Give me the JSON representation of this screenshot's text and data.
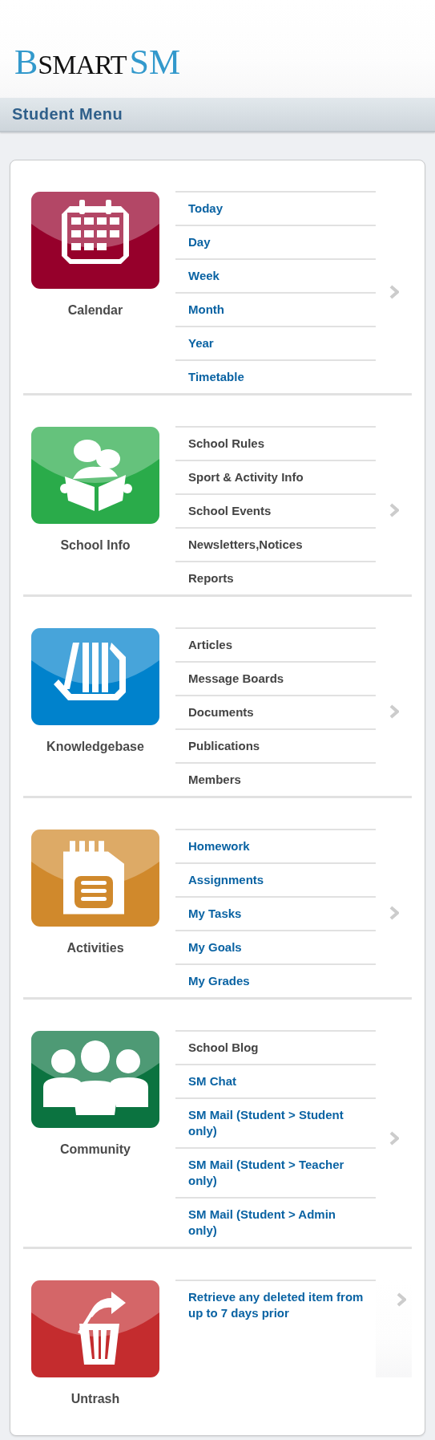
{
  "logo": {
    "initial": "B",
    "rest": "SMART",
    "suffix": "SM"
  },
  "menu_title": "Student Menu",
  "sections": [
    {
      "kind": "calendar",
      "label": "Calendar",
      "color": "#96002b",
      "items": [
        {
          "text": "Today",
          "linked": true
        },
        {
          "text": "Day",
          "linked": true
        },
        {
          "text": "Week",
          "linked": true
        },
        {
          "text": "Month",
          "linked": true
        },
        {
          "text": "Year",
          "linked": true
        },
        {
          "text": "Timetable",
          "linked": true
        }
      ]
    },
    {
      "kind": "reader",
      "label": "School Info",
      "color": "#2aab4a",
      "items": [
        {
          "text": "School Rules",
          "linked": false
        },
        {
          "text": "Sport & Activity Info",
          "linked": false
        },
        {
          "text": "School Events",
          "linked": false
        },
        {
          "text": "Newsletters,Notices",
          "linked": false
        },
        {
          "text": "Reports",
          "linked": false
        }
      ]
    },
    {
      "kind": "library",
      "label": "Knowledgebase",
      "color": "#0082cc",
      "items": [
        {
          "text": "Articles",
          "linked": false
        },
        {
          "text": "Message Boards",
          "linked": false
        },
        {
          "text": "Documents",
          "linked": false
        },
        {
          "text": "Publications",
          "linked": false
        },
        {
          "text": "Members",
          "linked": false
        }
      ]
    },
    {
      "kind": "memo",
      "label": "Activities",
      "color": "#d0892c",
      "items": [
        {
          "text": "Homework",
          "linked": true
        },
        {
          "text": "Assignments",
          "linked": true
        },
        {
          "text": "My Tasks",
          "linked": true
        },
        {
          "text": "My Goals",
          "linked": true
        },
        {
          "text": "My Grades",
          "linked": true
        }
      ]
    },
    {
      "kind": "group",
      "label": "Community",
      "color": "#0b7340",
      "items": [
        {
          "text": "School Blog",
          "linked": false
        },
        {
          "text": "SM Chat",
          "linked": true
        },
        {
          "text": "SM Mail (Student > Student only)",
          "linked": true
        },
        {
          "text": "SM Mail (Student > Teacher only)",
          "linked": true
        },
        {
          "text": "SM Mail (Student > Admin only)",
          "linked": true
        }
      ]
    },
    {
      "kind": "untrash",
      "label": "Untrash",
      "color": "#c42c2e",
      "items": [
        {
          "text": "Retrieve any deleted item from up to 7 days prior",
          "linked": true
        }
      ]
    }
  ]
}
